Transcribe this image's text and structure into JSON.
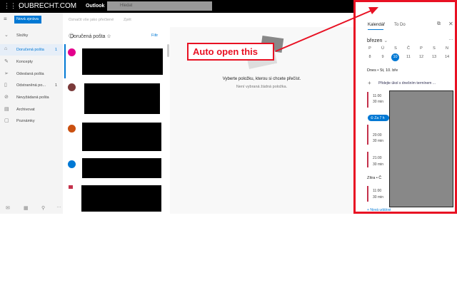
{
  "header": {
    "brand": "OUBRECHT.COM",
    "app": "Outlook",
    "search_placeholder": "Hledat"
  },
  "toolbar": {
    "new_message": "Nová zpráva",
    "mark_read": "Označit vše jako přečtené",
    "undo": "Zpět"
  },
  "nav": {
    "folders_label": "Složky",
    "items": [
      {
        "label": "Doručená pošta",
        "count": "1",
        "icon": "inbox-icon"
      },
      {
        "label": "Koncepty",
        "count": "",
        "icon": "pencil-icon"
      },
      {
        "label": "Odeslaná pošta",
        "count": "",
        "icon": "send-icon"
      },
      {
        "label": "Odstraněná po...",
        "count": "1",
        "icon": "trash-icon"
      },
      {
        "label": "Nevyžádaná pošta",
        "count": "",
        "icon": "junk-icon"
      },
      {
        "label": "Archivovat",
        "count": "",
        "icon": "archive-icon"
      },
      {
        "label": "Poznámky",
        "count": "",
        "icon": "note-icon"
      }
    ]
  },
  "list": {
    "title": "Doručená pošta",
    "filter": "Filtr"
  },
  "reading": {
    "title": "Vyberte položku, kterou si chcete přečíst.",
    "subtitle": "Není vybraná žádná položka."
  },
  "annotation": {
    "text": "Auto open this"
  },
  "panel": {
    "tabs": [
      "Kalendář",
      "To Do"
    ],
    "month": "březen",
    "weekdays": [
      "P",
      "Ú",
      "S",
      "Č",
      "P",
      "S",
      "N"
    ],
    "days": [
      "8",
      "9",
      "10",
      "11",
      "12",
      "13",
      "14"
    ],
    "selected_day": "10",
    "today": "Dnes • St, 10. bře",
    "add_task": "Přidejte úkol s dnešním termínem ...",
    "in_badge": "Za 7 h",
    "events": [
      {
        "time": "11:00",
        "dur": "30 min"
      },
      {
        "time": "20:00",
        "dur": "30 min"
      },
      {
        "time": "21:00",
        "dur": "30 min"
      }
    ],
    "tomorrow": "Zítra • Č",
    "tomorrow_events": [
      {
        "time": "11:00",
        "dur": "30 min"
      }
    ],
    "new_event": "Nová událost"
  },
  "colors": {
    "accent": "#0078d4",
    "highlight": "#e81123"
  }
}
